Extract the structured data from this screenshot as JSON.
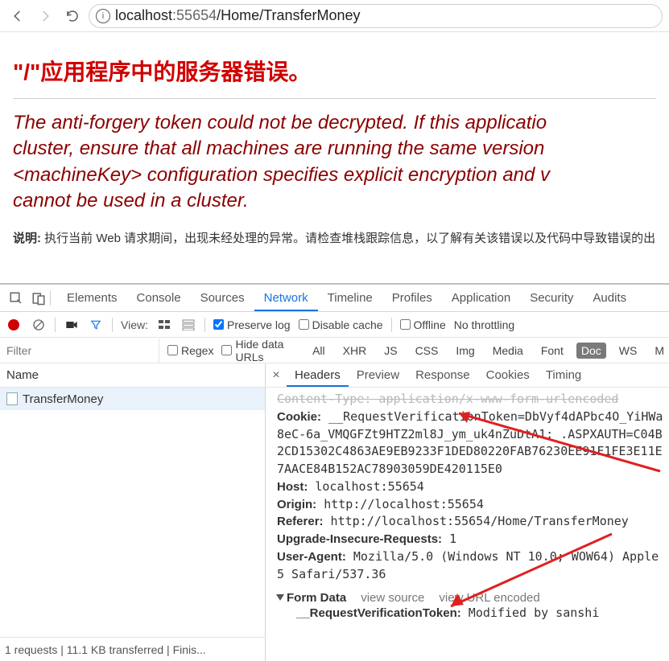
{
  "chrome": {
    "url_host": "localhost",
    "url_port": ":55654",
    "url_path": "/Home/TransferMoney"
  },
  "error": {
    "title": "\"/\"应用程序中的服务器错误。",
    "msg_l1": "The anti-forgery token could not be decrypted. If this applicatio",
    "msg_l2": "cluster, ensure that all machines are running the same version ",
    "msg_l3": "<machineKey> configuration specifies explicit encryption and v",
    "msg_l4": "cannot be used in a cluster.",
    "desc_label": "说明:",
    "desc_text": " 执行当前 Web 请求期间，出现未经处理的异常。请检查堆栈跟踪信息，以了解有关该错误以及代码中导致错误的出"
  },
  "devtools": {
    "tabs": [
      "Elements",
      "Console",
      "Sources",
      "Network",
      "Timeline",
      "Profiles",
      "Application",
      "Security",
      "Audits"
    ],
    "active_tab": "Network",
    "view_label": "View:",
    "preserve_log": "Preserve log",
    "disable_cache": "Disable cache",
    "offline": "Offline",
    "throttling": "No throttling",
    "filter_placeholder": "Filter",
    "regex": "Regex",
    "hide_data_urls": "Hide data URLs",
    "types": [
      "All",
      "XHR",
      "JS",
      "CSS",
      "Img",
      "Media",
      "Font",
      "Doc",
      "WS",
      "M"
    ],
    "types_active": "Doc",
    "name_header": "Name",
    "request_item": "TransferMoney",
    "footer": "1 requests | 11.1 KB transferred | Finis...",
    "detail_tabs": [
      "Headers",
      "Preview",
      "Response",
      "Cookies",
      "Timing"
    ],
    "detail_active": "Headers",
    "headers": {
      "content_type_cut": "Content-Type: application/x-www-form-urlencoded",
      "cookie_k": "Cookie:",
      "cookie_v": " __RequestVerificationToken=DbVyf4dAPbc4O_YiHWa",
      "cookie_l2": "8eC-6a_VMQGFZt9HTZ2ml8J_ym_uk4nZuDtA1; .ASPXAUTH=C04B",
      "cookie_l3": "2CD15302C4863AE9EB9233F1DED80220FAB76230EE91F1FE3E11E",
      "cookie_l4": "7AACE84B152AC78903059DE420115E0",
      "host_k": "Host:",
      "host_v": " localhost:55654",
      "origin_k": "Origin:",
      "origin_v": " http://localhost:55654",
      "referer_k": "Referer:",
      "referer_v": " http://localhost:55654/Home/TransferMoney",
      "uir_k": "Upgrade-Insecure-Requests:",
      "uir_v": " 1",
      "ua_k": "User-Agent:",
      "ua_v": " Mozilla/5.0 (Windows NT 10.0; WOW64) Apple",
      "ua_l2": "5 Safari/537.36",
      "form_section": "Form Data",
      "view_source": "view source",
      "view_url_enc": "view URL encoded",
      "form_k": "__RequestVerificationToken:",
      "form_v": " Modified by sanshi"
    }
  }
}
